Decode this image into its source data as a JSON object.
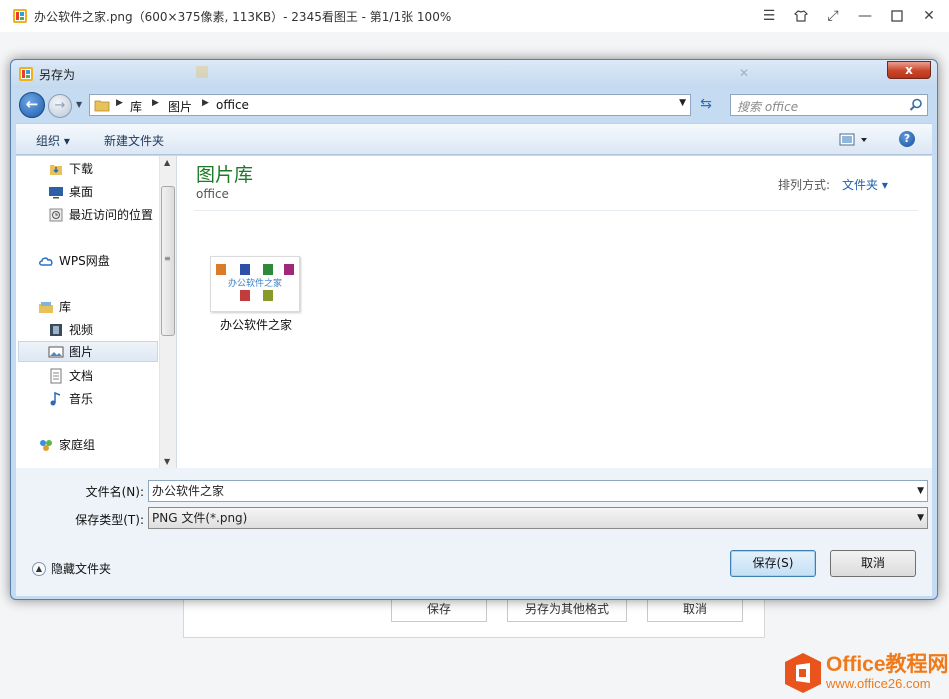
{
  "viewer": {
    "title": "办公软件之家.png（600×375像素, 113KB）- 2345看图王 - 第1/1张 100%",
    "controls": [
      "menu-icon",
      "skin-icon",
      "fullscreen-icon",
      "minimize-icon",
      "maximize-icon",
      "close-icon"
    ],
    "background_buttons": [
      "保存",
      "另存为其他格式",
      "取消"
    ]
  },
  "dialog": {
    "title": "另存为",
    "close_label": "x",
    "address": {
      "crumbs": [
        "库",
        "图片",
        "office"
      ]
    },
    "search_placeholder": "搜索 office",
    "toolbar": {
      "organize": "组织 ▾",
      "new_folder": "新建文件夹"
    },
    "nav_items": [
      {
        "label": "下载",
        "icon": "download-folder-icon"
      },
      {
        "label": "桌面",
        "icon": "desktop-icon"
      },
      {
        "label": "最近访问的位置",
        "icon": "recent-places-icon"
      },
      {
        "label": "WPS网盘",
        "icon": "cloud-icon"
      },
      {
        "label": "库",
        "icon": "library-icon"
      },
      {
        "label": "视频",
        "icon": "video-icon"
      },
      {
        "label": "图片",
        "icon": "pictures-icon",
        "selected": true
      },
      {
        "label": "文档",
        "icon": "documents-icon"
      },
      {
        "label": "音乐",
        "icon": "music-icon"
      },
      {
        "label": "家庭组",
        "icon": "homegroup-icon"
      }
    ],
    "content": {
      "library_title": "图片库",
      "library_subtitle": "office",
      "arrange_label": "排列方式:",
      "arrange_value": "文件夹 ▾",
      "files": [
        {
          "name": "办公软件之家",
          "thumb_text": "办公软件之家"
        }
      ]
    },
    "filename_label": "文件名(N):",
    "filename_value": "办公软件之家",
    "filetype_label": "保存类型(T):",
    "filetype_value": "PNG 文件(*.png)",
    "hide_folders": "隐藏文件夹",
    "save_button": "保存(S)",
    "cancel_button": "取消"
  },
  "watermark": {
    "line1": "Office教程网",
    "line2": "www.office26.com"
  },
  "colors": {
    "dialog_frame": "#c5dbf1",
    "library_title": "#1e7a28",
    "link_blue": "#1e5fae",
    "watermark": "#f07a1a"
  }
}
